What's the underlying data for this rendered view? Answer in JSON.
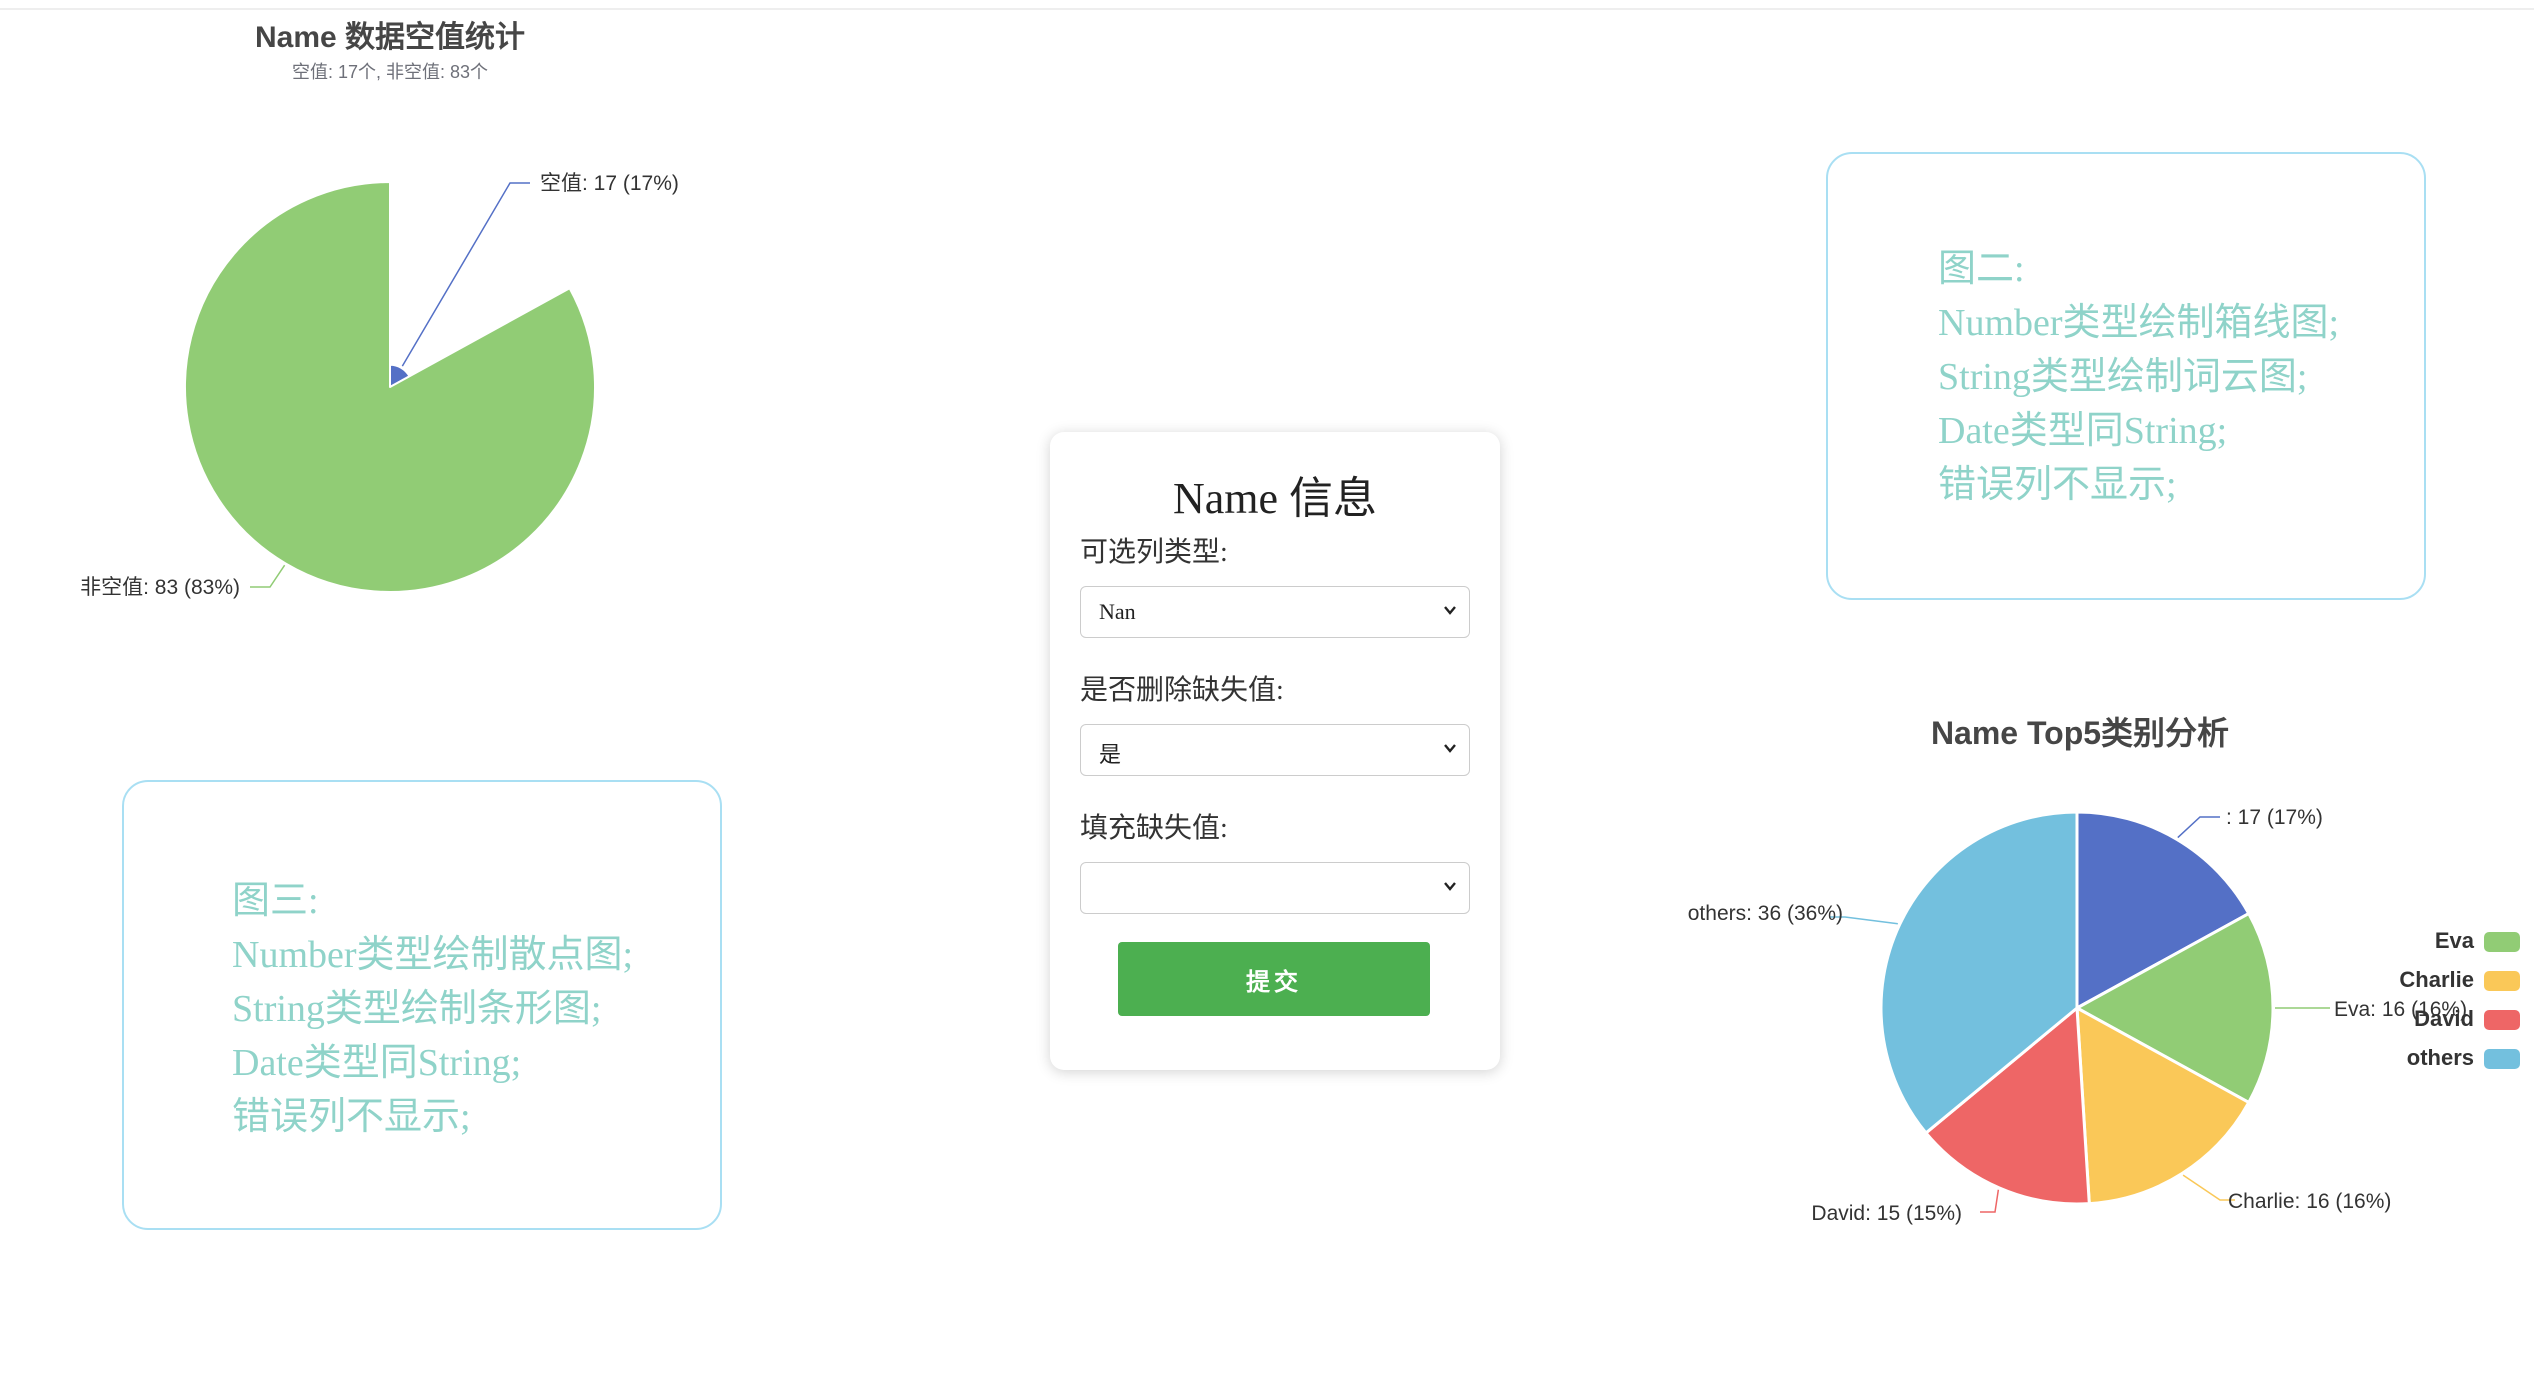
{
  "chart_data": [
    {
      "type": "pie",
      "title": "Name 数据空值统计",
      "subtitle": "空值: 17个, 非空值: 83个",
      "slices": [
        {
          "name": "空值",
          "value": 17,
          "label": "空值: 17 (17%)",
          "color": "#5470c6"
        },
        {
          "name": "非空值",
          "value": 83,
          "label": "非空值: 83 (83%)",
          "color": "#91cc75"
        }
      ]
    },
    {
      "type": "pie",
      "title": "Name Top5类别分析",
      "slices": [
        {
          "name": "",
          "value": 17,
          "label": ": 17 (17%)",
          "color": "#5470c6"
        },
        {
          "name": "Eva",
          "value": 16,
          "label": "Eva: 16 (16%)",
          "color": "#91cc75"
        },
        {
          "name": "Charlie",
          "value": 16,
          "label": "Charlie: 16 (16%)",
          "color": "#fac858"
        },
        {
          "name": "David",
          "value": 15,
          "label": "David: 15 (15%)",
          "color": "#ee6666"
        },
        {
          "name": "others",
          "value": 36,
          "label": "others: 36 (36%)",
          "color": "#73c0de"
        }
      ],
      "legend": {
        "position": "right",
        "items": [
          {
            "name": "Eva",
            "color": "#91cc75"
          },
          {
            "name": "Charlie",
            "color": "#fac858"
          },
          {
            "name": "David",
            "color": "#ee6666"
          },
          {
            "name": "others",
            "color": "#73c0de"
          }
        ]
      }
    }
  ],
  "info_cards": {
    "fig2": {
      "lines": [
        "图二:",
        "Number类型绘制箱线图;",
        "String类型绘制词云图;",
        "Date类型同String;",
        "错误列不显示;"
      ]
    },
    "fig3": {
      "lines": [
        "图三:",
        "Number类型绘制散点图;",
        "String类型绘制条形图;",
        "Date类型同String;",
        "错误列不显示;"
      ]
    }
  },
  "form": {
    "title": "Name 信息",
    "column_type_label": "可选列类型:",
    "column_type_value": "Nan",
    "drop_missing_label": "是否删除缺失值:",
    "drop_missing_value": "是",
    "fill_missing_label": "填充缺失值:",
    "fill_missing_value": "",
    "submit_label": "提交"
  },
  "colors": {
    "card_border": "#a9dff3",
    "card_text": "#8fd3c9",
    "submit": "#4caf50"
  }
}
